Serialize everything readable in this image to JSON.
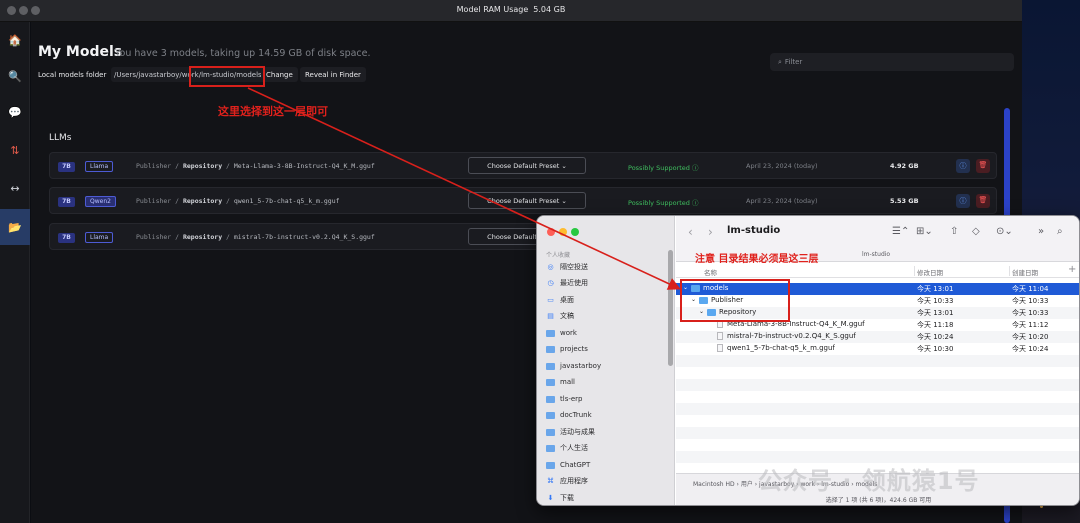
{
  "window": {
    "title": "Model RAM Usage",
    "ram_value": "5.04 GB"
  },
  "sidebar": {
    "items": [
      {
        "name": "home",
        "glyph": "🏠"
      },
      {
        "name": "search",
        "glyph": "🔍"
      },
      {
        "name": "chat",
        "glyph": "💬"
      },
      {
        "name": "server",
        "glyph": "⇅"
      },
      {
        "name": "arrows",
        "glyph": "↔"
      },
      {
        "name": "models-folder",
        "glyph": "📂"
      }
    ]
  },
  "main": {
    "heading": "My Models",
    "subtitle": "You have 3 models, taking up 14.59 GB of disk space.",
    "filter_placeholder": "Filter",
    "folder_label": "Local models folder",
    "folder_path": "/Users/javastarboy/work/lm-studio/models",
    "change_label": "Change",
    "reveal_label": "Reveal in Finder",
    "section_label": "LLMs",
    "models": [
      {
        "params": "7B",
        "arch": "Llama",
        "publisher": "Publisher",
        "repository": "Repository",
        "file": "Meta-Llama-3-8B-Instruct-Q4_K_M.gguf",
        "preset": "Choose Default Preset",
        "support": "Possibly Supported",
        "date": "April 23, 2024 (today)",
        "size": "4.92 GB"
      },
      {
        "params": "7B",
        "arch": "Qwen2",
        "publisher": "Publisher",
        "repository": "Repository",
        "file": "qwen1_5-7b-chat-q5_k_m.gguf",
        "preset": "Choose Default Preset",
        "support": "Possibly Supported",
        "date": "April 23, 2024 (today)",
        "size": "5.53 GB"
      },
      {
        "params": "7B",
        "arch": "Llama",
        "publisher": "Publisher",
        "repository": "Repository",
        "file": "mistral-7b-instruct-v0.2.Q4_K_S.gguf",
        "preset": "Choose Default Preset",
        "support": "",
        "date": "",
        "size": ""
      }
    ]
  },
  "annotations": {
    "select_here": "这里选择到这一层即可",
    "note_three_levels": "注意 目录结果必须是这三层"
  },
  "finder": {
    "title": "lm-studio",
    "path_hint": "lm-studio",
    "section": "个人收藏",
    "favorites": [
      {
        "label": "隔空投送",
        "icon": "airdrop-icon",
        "glyph": "◎"
      },
      {
        "label": "最近使用",
        "icon": "clock-icon",
        "glyph": "◷"
      },
      {
        "label": "桌面",
        "icon": "desktop-icon",
        "glyph": "▭"
      },
      {
        "label": "文稿",
        "icon": "document-icon",
        "glyph": "▤"
      },
      {
        "label": "work",
        "icon": "folder-icon",
        "glyph": ""
      },
      {
        "label": "projects",
        "icon": "folder-icon",
        "glyph": ""
      },
      {
        "label": "javastarboy",
        "icon": "folder-icon",
        "glyph": ""
      },
      {
        "label": "mall",
        "icon": "folder-icon",
        "glyph": ""
      },
      {
        "label": "tls-erp",
        "icon": "folder-icon",
        "glyph": ""
      },
      {
        "label": "docTrunk",
        "icon": "folder-icon",
        "glyph": ""
      },
      {
        "label": "活动与成果",
        "icon": "folder-icon",
        "glyph": ""
      },
      {
        "label": "个人生活",
        "icon": "folder-icon",
        "glyph": ""
      },
      {
        "label": "ChatGPT",
        "icon": "folder-icon",
        "glyph": ""
      },
      {
        "label": "应用程序",
        "icon": "apps-icon",
        "glyph": "⌘"
      },
      {
        "label": "下载",
        "icon": "download-icon",
        "glyph": "⬇"
      }
    ],
    "columns": {
      "name": "名称",
      "modified": "修改日期",
      "created": "创建日期"
    },
    "rows": [
      {
        "disc": "⌄",
        "kind": "folder",
        "name": "models",
        "modified": "今天 13:01",
        "created": "今天 11:04"
      },
      {
        "disc": "⌄",
        "kind": "folder",
        "name": "Publisher",
        "modified": "今天 10:33",
        "created": "今天 10:33"
      },
      {
        "disc": "⌄",
        "kind": "folder",
        "name": "Repository",
        "modified": "今天 13:01",
        "created": "今天 10:33"
      },
      {
        "disc": "",
        "kind": "file",
        "name": "Meta-Llama-3-8B-Instruct-Q4_K_M.gguf",
        "modified": "今天 11:18",
        "created": "今天 11:12"
      },
      {
        "disc": "",
        "kind": "file",
        "name": "mistral-7b-instruct-v0.2.Q4_K_S.gguf",
        "modified": "今天 10:24",
        "created": "今天 10:20"
      },
      {
        "disc": "",
        "kind": "file",
        "name": "qwen1_5-7b-chat-q5_k_m.gguf",
        "modified": "今天 10:30",
        "created": "今天 10:24"
      }
    ],
    "breadcrumbs": "Macintosh HD › 用户 › javastarboy › work › lm-studio › models",
    "status": "选择了 1 项 (共 6 项)，424.6 GB 可用"
  },
  "watermark": "公众号 · 领航猿1号"
}
